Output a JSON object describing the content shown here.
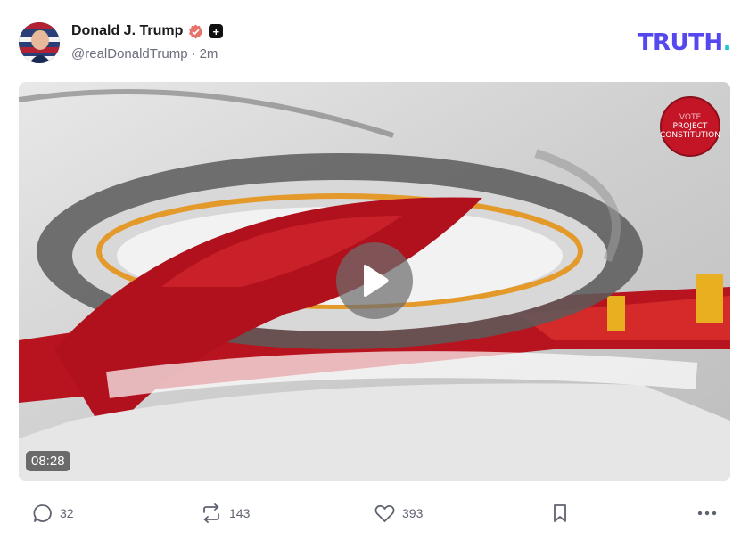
{
  "post": {
    "author": {
      "display_name": "Donald J. Trump",
      "handle": "@realDonaldTrump",
      "separator": "·",
      "time": "2m",
      "verified_icon": "verified-badge-icon",
      "plus_icon": "plus-badge-icon"
    },
    "brand": {
      "logo_text": "TRUTH",
      "logo_dot": ".",
      "logo_color": "#5448ee",
      "dot_color": "#17c7d3"
    },
    "video": {
      "duration": "08:28",
      "play_icon": "play-icon",
      "watermark_top": "VOTE",
      "watermark_line1": "PROJECT",
      "watermark_line2": "CONSTITUTION"
    },
    "actions": {
      "replies": "32",
      "reposts": "143",
      "likes": "393",
      "reply_icon": "reply-icon",
      "repost_icon": "repost-icon",
      "like_icon": "heart-icon",
      "bookmark_icon": "bookmark-icon",
      "more_icon": "more-icon"
    }
  }
}
